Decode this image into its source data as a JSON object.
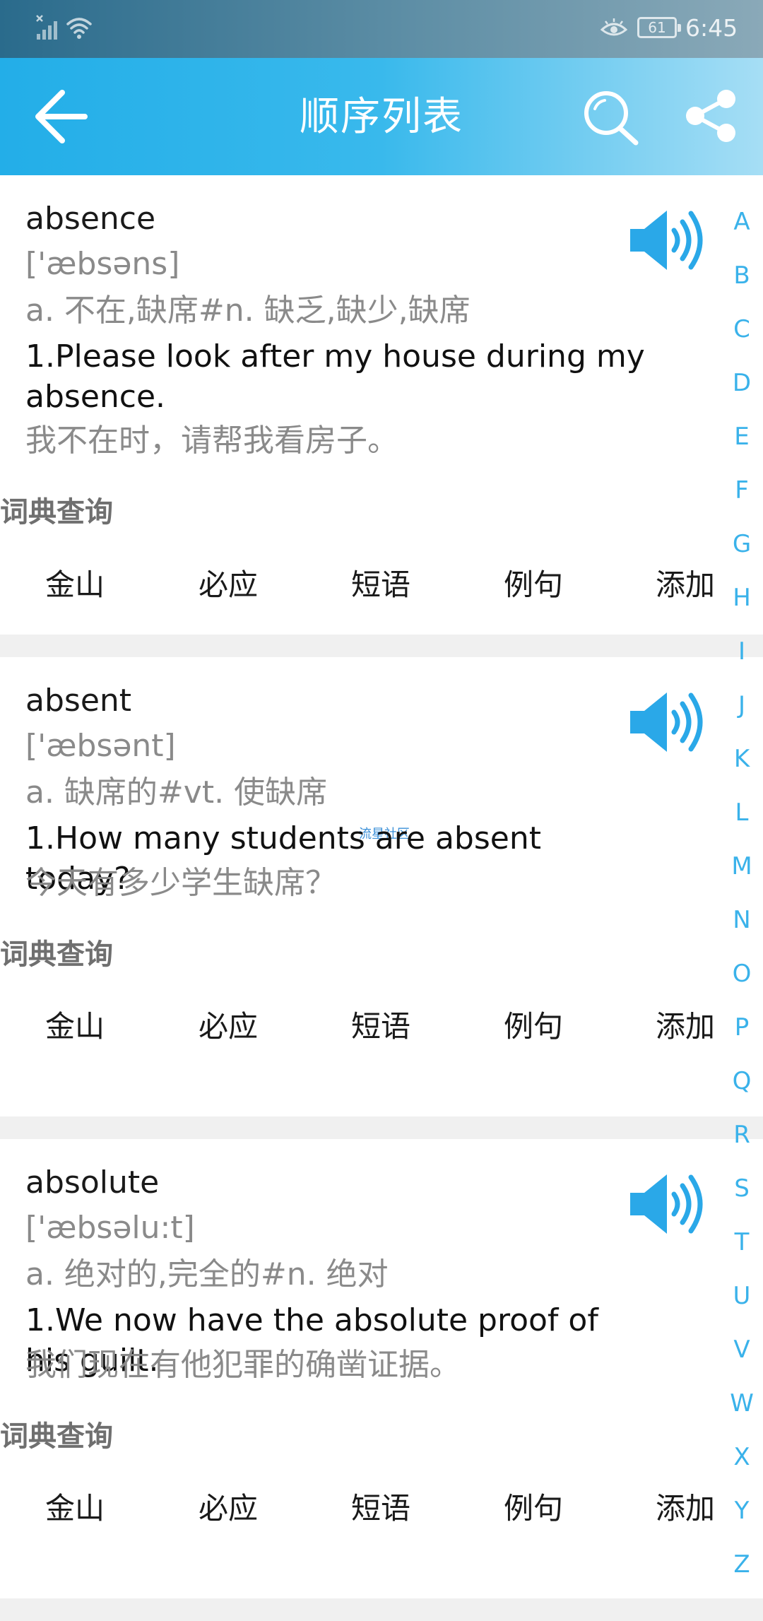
{
  "status": {
    "battery": "61",
    "time": "6:45"
  },
  "header": {
    "title": "顺序列表"
  },
  "entries": [
    {
      "word": "absence",
      "phonetic": "['æbsəns]",
      "meaning": "a. 不在,缺席#n. 缺乏,缺少,缺席",
      "example": "1.Please look after my house during my absence.",
      "translation": "我不在时，请帮我看房子。",
      "dict_label": "词典查询",
      "actions": [
        "金山",
        "必应",
        "短语",
        "例句",
        "添加"
      ]
    },
    {
      "word": "absent",
      "phonetic": "['æbsənt]",
      "meaning": "a. 缺席的#vt. 使缺席",
      "example": "1.How many students are absent today?",
      "translation": "今天有多少学生缺席？",
      "dict_label": "词典查询",
      "actions": [
        "金山",
        "必应",
        "短语",
        "例句",
        "添加"
      ],
      "watermark": "流星社区"
    },
    {
      "word": "absolute",
      "phonetic": "['æbsəlu:t]",
      "meaning": "a. 绝对的,完全的#n. 绝对",
      "example": "1.We now have the absolute proof of his guilt.",
      "translation": "我们现在有他犯罪的确凿证据。",
      "dict_label": "词典查询",
      "actions": [
        "金山",
        "必应",
        "短语",
        "例句",
        "添加"
      ]
    }
  ],
  "alphabet": [
    "A",
    "B",
    "C",
    "D",
    "E",
    "F",
    "G",
    "H",
    "I",
    "J",
    "K",
    "L",
    "M",
    "N",
    "O",
    "P",
    "Q",
    "R",
    "S",
    "T",
    "U",
    "V",
    "W",
    "X",
    "Y",
    "Z"
  ],
  "colors": {
    "accent": "#23aee8",
    "index_letters": "#3ab2ea",
    "speaker": "#2aa8e8"
  }
}
